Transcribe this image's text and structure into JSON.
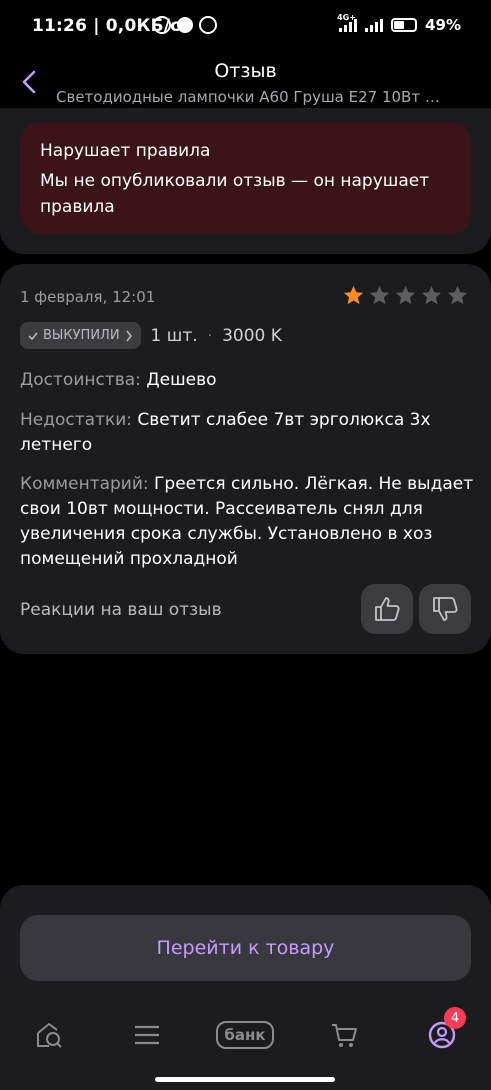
{
  "status_bar": {
    "time": "11:26",
    "speed": "0,0КБ/с",
    "network": "4G+",
    "battery": "49%"
  },
  "header": {
    "title": "Отзыв",
    "subtitle": "Светодиодные лампочки А60 Груша E27 10Вт т..."
  },
  "violation": {
    "title": "Нарушает правила",
    "text": "Мы не опубликовали отзыв — он нарушает правила"
  },
  "review": {
    "date": "1 февраля, 12:01",
    "rating": 1,
    "max_rating": 5,
    "purchased_label": "ВЫКУПИЛИ",
    "quantity": "1 шт.",
    "size": "3000 K",
    "pros_label": "Достоинства:",
    "pros_text": "Дешево",
    "cons_label": "Недостатки:",
    "cons_text": "Светит слабее 7вт эрголюкса 3х летнего",
    "comment_label": "Комментарий:",
    "comment_text": "Греется сильно.  Лёгкая. Не выдает свои 10вт мощности. Рассеиватель снял для увеличения срока службы. Установлено в хоз помещений прохладной",
    "reactions_label": "Реакции на ваш отзыв"
  },
  "bottom": {
    "goto_label": "Перейти к товару",
    "bank_label": "банк",
    "profile_badge": "4"
  },
  "colors": {
    "accent": "#c59bff",
    "star_active": "#ff8a1f",
    "star_inactive": "#5c5c62",
    "violation_bg": "#3b1419",
    "badge": "#ff3a55"
  },
  "icons": [
    "back-icon",
    "star-icon",
    "check-icon",
    "chevron-right-icon",
    "thumb-up-icon",
    "thumb-down-icon",
    "home-search-icon",
    "menu-icon",
    "bank-icon",
    "cart-icon",
    "profile-icon"
  ]
}
